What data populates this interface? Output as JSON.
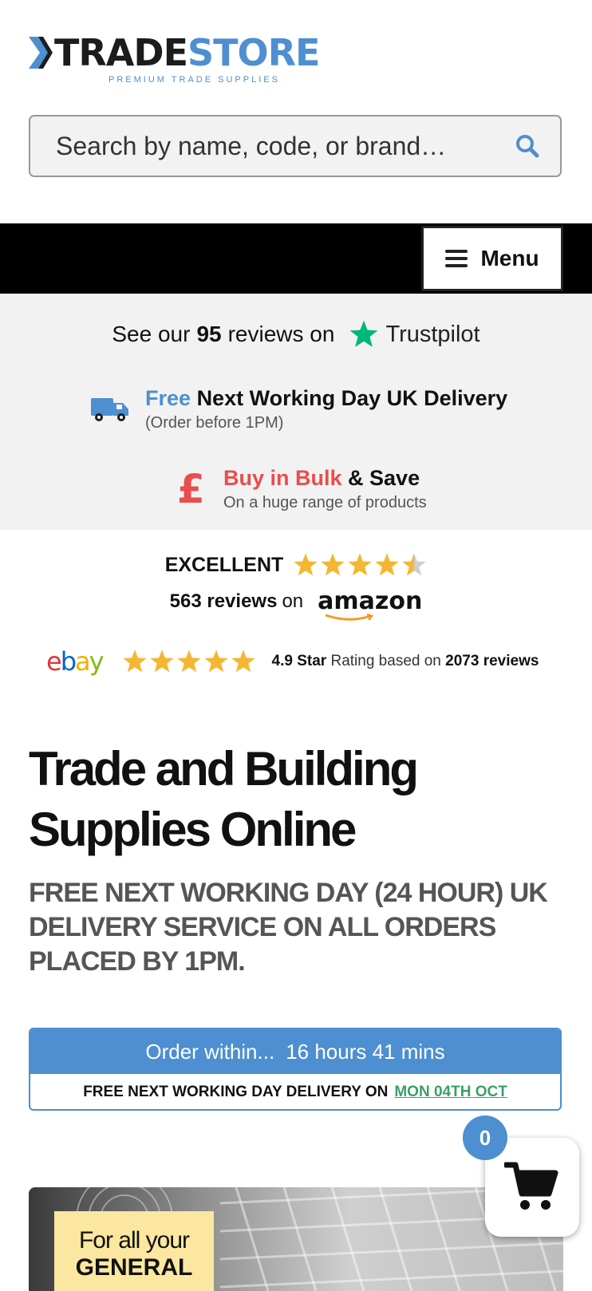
{
  "header": {
    "logo_trade": "TRADE",
    "logo_store": "STORE",
    "logo_tagline": "PREMIUM TRADE SUPPLIES"
  },
  "search": {
    "placeholder": "Search by name, code, or brand…"
  },
  "nav": {
    "menu_label": "Menu"
  },
  "promos": {
    "trustpilot_prefix": "See our",
    "trustpilot_count": "95",
    "trustpilot_suffix": "reviews on",
    "trustpilot_brand": "Trustpilot",
    "delivery_highlight": "Free",
    "delivery_title": "Next Working Day UK Delivery",
    "delivery_sub": "(Order before 1PM)",
    "bulk_highlight": "Buy in Bulk",
    "bulk_title": "& Save",
    "bulk_sub": "On a huge range of products"
  },
  "amazon": {
    "rating_word": "EXCELLENT",
    "rating": 4.5,
    "review_count": "563 reviews",
    "on_text": "on",
    "brand": "amazon"
  },
  "ebay": {
    "logo": [
      "e",
      "b",
      "a",
      "y"
    ],
    "rating": 5,
    "rating_text": "4.9 Star",
    "rating_mid": "Rating based on",
    "reviews": "2073 reviews"
  },
  "main": {
    "title": "Trade and Building Supplies Online",
    "subtitle": "FREE NEXT WORKING DAY (24 HOUR) UK DELIVERY SERVICE ON ALL ORDERS PLACED BY 1PM."
  },
  "countdown": {
    "label": "Order within...",
    "time": "16 hours 41 mins",
    "delivery_text": "FREE NEXT WORKING DAY DELIVERY ON",
    "delivery_date": "MON 04TH OCT"
  },
  "cart": {
    "count": "0"
  },
  "banner": {
    "line1": "For all your",
    "line2": "GENERAL"
  },
  "colors": {
    "brand_blue": "#4d8fd0",
    "accent_red": "#e94d4d",
    "trustpilot_green": "#00b67a",
    "star_gold": "#f5b731",
    "date_green": "#3aa06a"
  },
  "icons": {
    "search": "search-icon",
    "menu": "hamburger-icon",
    "trustpilot": "trustpilot-star-icon",
    "delivery": "truck-icon",
    "bulk": "pound-icon",
    "cart": "cart-icon"
  }
}
